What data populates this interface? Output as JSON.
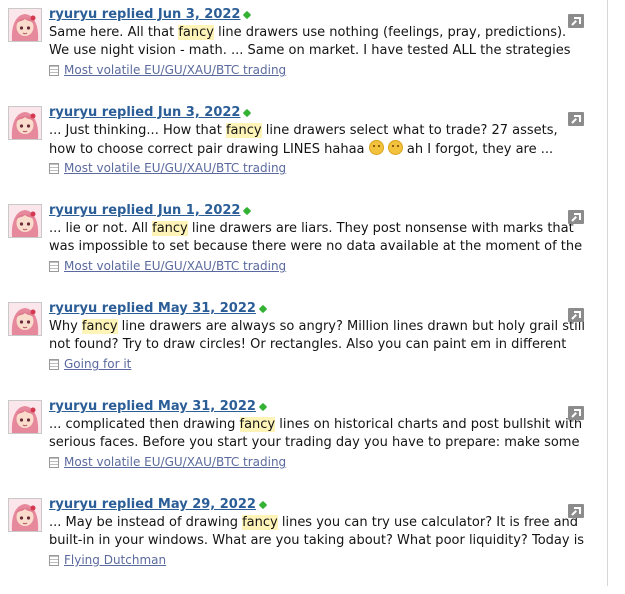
{
  "results": [
    {
      "author": "ryuryu",
      "action": "replied",
      "date": "Jun 3, 2022",
      "lines": [
        [
          [
            "Same here. All that ",
            false
          ],
          [
            "fancy",
            true
          ],
          [
            " line drawers use nothing (feelings, pray, predictions).",
            false
          ]
        ],
        [
          [
            "We use night vision - math. ... Same on market. I have tested ALL the strategies",
            false
          ]
        ]
      ],
      "forum": "Most volatile EU/GU/XAU/BTC trading"
    },
    {
      "author": "ryuryu",
      "action": "replied",
      "date": "Jun 3, 2022",
      "lines": [
        [
          [
            "... Just thinking... How that ",
            false
          ],
          [
            "fancy",
            true
          ],
          [
            " line drawers select what to trade? 27 assets,",
            false
          ]
        ],
        [
          [
            "how to choose correct pair drawing LINES hahaa ",
            false
          ],
          [
            "__E__",
            false
          ],
          [
            " ",
            false
          ],
          [
            "__E__",
            false
          ],
          [
            " ah I forgot, they are ...",
            false
          ]
        ]
      ],
      "forum": "Most volatile EU/GU/XAU/BTC trading"
    },
    {
      "author": "ryuryu",
      "action": "replied",
      "date": "Jun 1, 2022",
      "lines": [
        [
          [
            "... lie or not. All ",
            false
          ],
          [
            "fancy",
            true
          ],
          [
            " line drawers are liars. They post nonsense with marks that",
            false
          ]
        ],
        [
          [
            "was impossible to set because there were no data available at the moment of the",
            false
          ]
        ]
      ],
      "forum": "Most volatile EU/GU/XAU/BTC trading"
    },
    {
      "author": "ryuryu",
      "action": "replied",
      "date": "May 31, 2022",
      "lines": [
        [
          [
            "Why ",
            false
          ],
          [
            "fancy",
            true
          ],
          [
            " line drawers are always so angry? Million lines drawn but holy grail still",
            false
          ]
        ],
        [
          [
            "not found? Try to draw circles! Or rectangles. Also you can paint em in different",
            false
          ]
        ]
      ],
      "forum": "Going for it"
    },
    {
      "author": "ryuryu",
      "action": "replied",
      "date": "May 31, 2022",
      "lines": [
        [
          [
            "... complicated then drawing ",
            false
          ],
          [
            "fancy",
            true
          ],
          [
            " lines on historical charts and post bullshit with",
            false
          ]
        ],
        [
          [
            "serious faces. Before you start your trading day you have to prepare: make some",
            false
          ]
        ]
      ],
      "forum": "Most volatile EU/GU/XAU/BTC trading"
    },
    {
      "author": "ryuryu",
      "action": "replied",
      "date": "May 29, 2022",
      "lines": [
        [
          [
            "... May be instead of drawing ",
            false
          ],
          [
            "fancy",
            true
          ],
          [
            " lines you can try use calculator? It is free and",
            false
          ]
        ],
        [
          [
            "built-in in your windows. What are you taking about? What poor liquidity? Today is",
            false
          ]
        ]
      ],
      "forum": "Flying Dutchman"
    }
  ],
  "colors": {
    "link": "#2b5d97",
    "forum_link": "#5b6a9e",
    "highlight": "#fff4b8",
    "online_dot": "#34b233"
  },
  "icons": {
    "avatar": "anime-avatar",
    "forum": "forum-icon",
    "expand": "expand-arrow-icon",
    "online": "online-indicator-icon"
  }
}
